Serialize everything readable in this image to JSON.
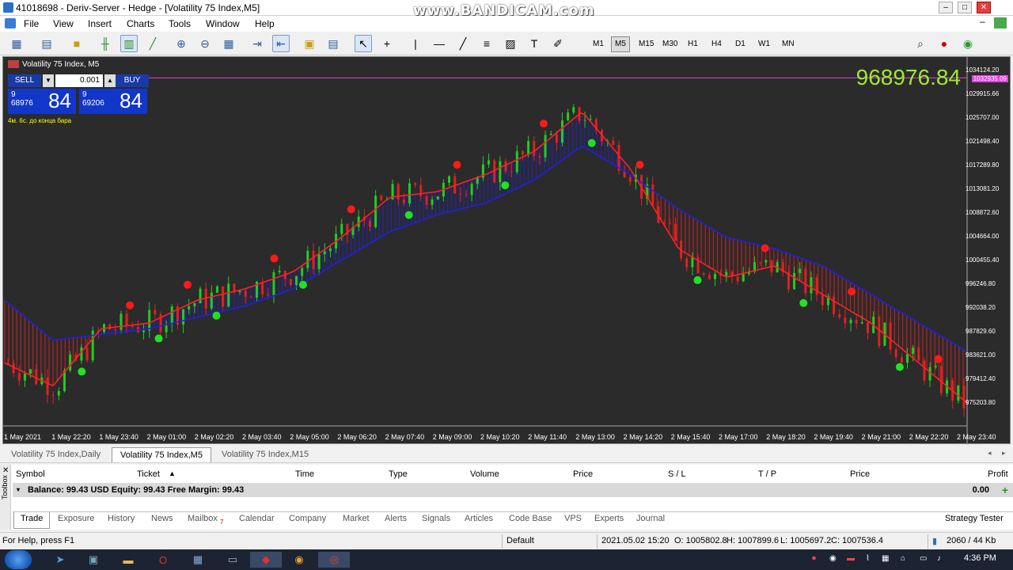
{
  "window": {
    "title": "41018698 - Deriv-Server - Hedge - [Volatility 75 Index,M5]",
    "watermark": "www.BANDICAM.com"
  },
  "menu": [
    "File",
    "View",
    "Insert",
    "Charts",
    "Tools",
    "Window",
    "Help"
  ],
  "timeframes": [
    "M1",
    "M5",
    "M15",
    "M30",
    "H1",
    "H4",
    "D1",
    "W1",
    "MN"
  ],
  "active_timeframe": "M5",
  "chart": {
    "title": "Volatility 75 Index, M5",
    "big_price": "968976.84",
    "current_price_tag": "1032935.09",
    "countdown": "4м. 6с. до конца бара",
    "one_click": {
      "sell_label": "SELL",
      "buy_label": "BUY",
      "lot": "0.001",
      "sell_small_top": "9",
      "sell_small_bottom": "68976",
      "sell_big": "84",
      "buy_small_top": "9",
      "buy_small_bottom": "69206",
      "buy_big": "84"
    },
    "y_labels": [
      "1034124.20",
      "1029915.66",
      "1025707.00",
      "1021498.40",
      "1017289.80",
      "1013081.20",
      "1008872.60",
      "1004664.00",
      "1000455.40",
      "996246.80",
      "992038.20",
      "987829.60",
      "983621.00",
      "979412.40",
      "975203.80"
    ],
    "x_labels": [
      "1 May 2021",
      "1 May 22:20",
      "1 May 23:40",
      "2 May 01:00",
      "2 May 02:20",
      "2 May 03:40",
      "2 May 05:00",
      "2 May 06:20",
      "2 May 07:40",
      "2 May 09:00",
      "2 May 10:20",
      "2 May 11:40",
      "2 May 13:00",
      "2 May 14:20",
      "2 May 15:40",
      "2 May 17:00",
      "2 May 18:20",
      "2 May 19:40",
      "2 May 21:00",
      "2 May 22:20",
      "2 May 23:40"
    ],
    "colors": {
      "bg": "#2b2b2b",
      "bull": "#22cc22",
      "bear": "#e02020",
      "fast_ma": "#ff2020",
      "slow_ma": "#2020e0",
      "price_line": "#e040e0"
    }
  },
  "chart_data": {
    "type": "line",
    "x": [
      "1 May 2021",
      "1 May 22:20",
      "1 May 23:40",
      "2 May 01:00",
      "2 May 02:20",
      "2 May 03:40",
      "2 May 05:00",
      "2 May 06:20",
      "2 May 07:40",
      "2 May 09:00",
      "2 May 10:20",
      "2 May 11:40",
      "2 May 13:00",
      "2 May 14:20",
      "2 May 15:40",
      "2 May 17:00",
      "2 May 18:20",
      "2 May 19:40",
      "2 May 21:00",
      "2 May 22:20",
      "2 May 23:40"
    ],
    "series": [
      {
        "values": [
          983000,
          979000,
          989000,
          990000,
          994000,
          996000,
          999000,
          1005000,
          1012000,
          1013000,
          1016000,
          1020000,
          1027000,
          1017000,
          1003000,
          998000,
          1000000,
          995000,
          990000,
          983000,
          976000
        ]
      },
      {
        "values": [
          994000,
          987000,
          988000,
          989000,
          991000,
          993000,
          996000,
          1001000,
          1006000,
          1009000,
          1011000,
          1015000,
          1021000,
          1016000,
          1010000,
          1005000,
          1003000,
          1000000,
          995000,
          990000,
          985000
        ]
      }
    ],
    "ylim": [
      972000,
      1036000
    ],
    "grid": false,
    "legend": "none"
  },
  "chart_tabs": [
    "Volatility 75 Index,Daily",
    "Volatility 75 Index,M5",
    "Volatility 75 Index,M15"
  ],
  "active_chart_tab": "Volatility 75 Index,M5",
  "terminal": {
    "side_label": "Toolbox",
    "columns": [
      "Symbol",
      "Ticket",
      "Time",
      "Type",
      "Volume",
      "Price",
      "S / L",
      "T / P",
      "Price",
      "Profit"
    ],
    "balance_text": "Balance: 99.43 USD  Equity: 99.43  Free Margin: 99.43",
    "profit_total": "0.00",
    "tabs": [
      "Trade",
      "Exposure",
      "History",
      "News",
      "Mailbox",
      "Calendar",
      "Company",
      "Market",
      "Alerts",
      "Signals",
      "Articles",
      "Code Base",
      "VPS",
      "Experts",
      "Journal"
    ],
    "mailbox_badge": "7",
    "strategy_tester": "Strategy Tester"
  },
  "status": {
    "help": "For Help, press F1",
    "profile": "Default",
    "datetime": "2021.05.02 15:20",
    "open": "O: 1005802.8",
    "high": "H: 1007899.6",
    "low": "L: 1005697.2",
    "close": "C: 1007536.4",
    "traffic": "2060 / 44 Kb"
  },
  "taskbar": {
    "clock": "4:36 PM"
  }
}
